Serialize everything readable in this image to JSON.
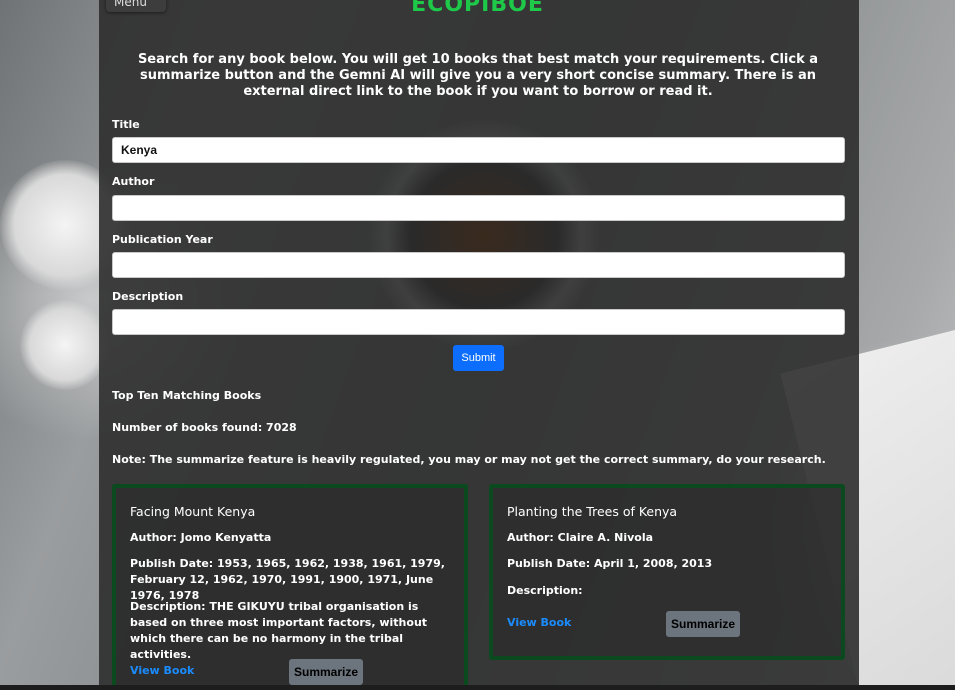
{
  "header": {
    "menu_label": "Menu",
    "brand": "ECOPIBOE"
  },
  "intro_text": "Search for any book below. You will get 10 books that best match your requirements. Click a summarize button and the Gemni AI will give you a very short concise summary. There is an external direct link to the book if you want to borrow or read it.",
  "form": {
    "title": {
      "label": "Title",
      "value": "Kenya"
    },
    "author": {
      "label": "Author",
      "value": ""
    },
    "year": {
      "label": "Publication Year",
      "value": ""
    },
    "description": {
      "label": "Description",
      "value": ""
    },
    "submit_label": "Submit"
  },
  "results": {
    "heading": "Top Ten Matching Books",
    "count_text": "Number of books found: 7028",
    "note": "Note: The summarize feature is heavily regulated, you may or may not get the correct summary, do your research."
  },
  "books": [
    {
      "title": "Facing Mount Kenya",
      "author": "Author: Jomo Kenyatta",
      "publish": "Publish Date: 1953, 1965, 1962, 1938, 1961, 1979, February 12, 1962, 1970, 1991, 1900, 1971, June 1976, 1978",
      "description": "Description: THE GIKUYU tribal organisation is based on three most important factors, without which there can be no harmony in the tribal activities.",
      "view_label": "View Book",
      "summarize_label": "Summarize"
    },
    {
      "title": "Planting the Trees of Kenya",
      "author": "Author: Claire A. Nivola",
      "publish": "Publish Date: April 1, 2008, 2013",
      "description": "Description:",
      "view_label": "View Book",
      "summarize_label": "Summarize"
    }
  ],
  "colors": {
    "brand": "#1ec94a",
    "submit": "#0d6efd",
    "card_border": "#0b4a1f",
    "link": "#1a8cff",
    "summarize_button": "#6c757d"
  }
}
